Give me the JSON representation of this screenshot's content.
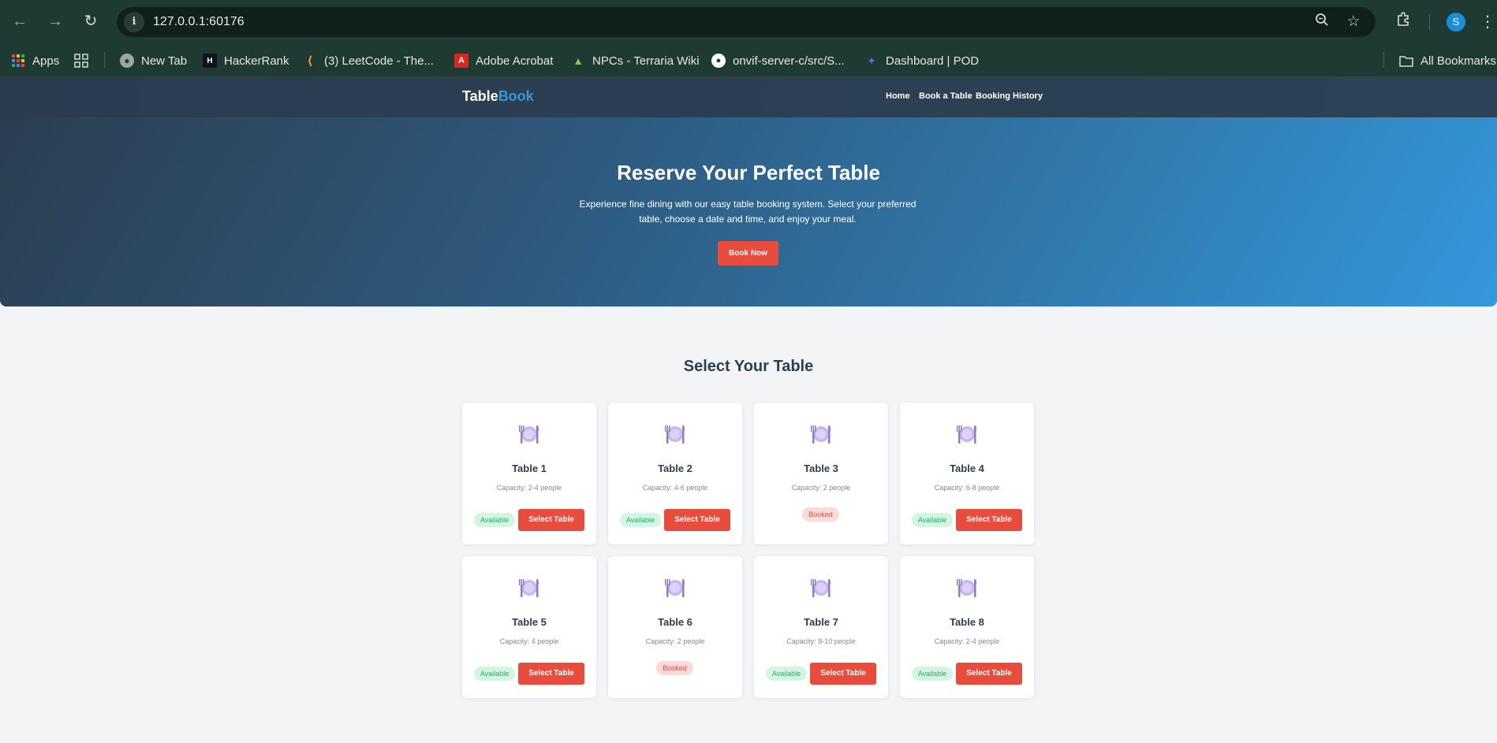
{
  "browser": {
    "url": "127.0.0.1:60176",
    "profile_initial": "S",
    "bookmarks": [
      {
        "label": "Apps",
        "icon": "apps-grid-icon"
      },
      {
        "label": "New Tab",
        "icon": "globe-icon"
      },
      {
        "label": "HackerRank",
        "icon": "hackerrank-icon"
      },
      {
        "label": "(3) LeetCode - The...",
        "icon": "leetcode-icon"
      },
      {
        "label": "Adobe Acrobat",
        "icon": "acrobat-icon"
      },
      {
        "label": "NPCs - Terraria Wiki",
        "icon": "terraria-icon"
      },
      {
        "label": "onvif-server-c/src/S...",
        "icon": "github-icon"
      },
      {
        "label": "Dashboard | POD",
        "icon": "pod-icon"
      }
    ],
    "all_bookmarks": "All Bookmarks"
  },
  "site": {
    "logo_part1": "Table",
    "logo_part2": "Book",
    "nav": [
      "Home",
      "Book a Table",
      "Booking History"
    ]
  },
  "hero": {
    "title": "Reserve Your Perfect Table",
    "description": "Experience fine dining with our easy table booking system. Select your preferred table, choose a date and time, and enjoy your meal.",
    "button": "Book Now"
  },
  "tables_section": {
    "title": "Select Your Table",
    "available_label": "Available",
    "booked_label": "Booked",
    "select_label": "Select Table",
    "tables": [
      {
        "name": "Table 1",
        "capacity": "Capacity: 2-4 people",
        "status": "available"
      },
      {
        "name": "Table 2",
        "capacity": "Capacity: 4-6 people",
        "status": "available"
      },
      {
        "name": "Table 3",
        "capacity": "Capacity: 2 people",
        "status": "booked"
      },
      {
        "name": "Table 4",
        "capacity": "Capacity: 6-8 people",
        "status": "available"
      },
      {
        "name": "Table 5",
        "capacity": "Capacity: 4 people",
        "status": "available"
      },
      {
        "name": "Table 6",
        "capacity": "Capacity: 2 people",
        "status": "booked"
      },
      {
        "name": "Table 7",
        "capacity": "Capacity: 8-10 people",
        "status": "available"
      },
      {
        "name": "Table 8",
        "capacity": "Capacity: 2-4 people",
        "status": "available"
      }
    ]
  },
  "colors": {
    "primary_dark": "#2c3e50",
    "accent_blue": "#3498db",
    "button_red": "#e74c3c",
    "available_green": "#27ae60"
  }
}
